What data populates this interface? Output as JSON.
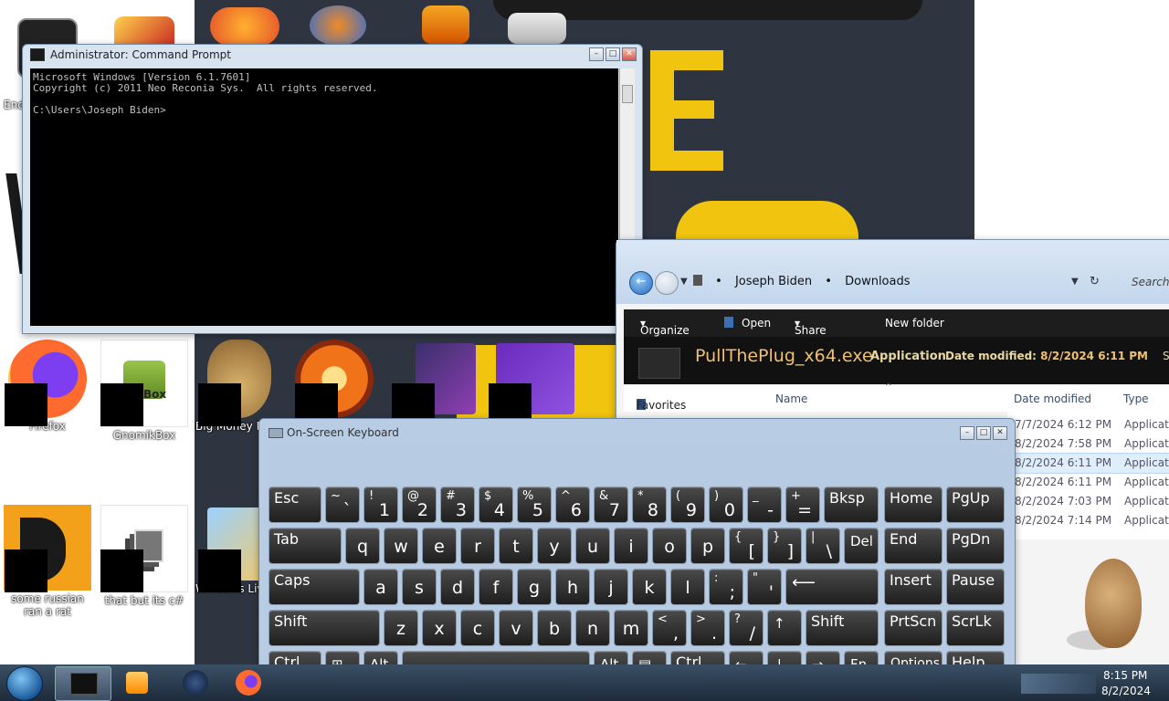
{
  "desktop": {
    "icons": [
      {
        "label": "Firefox"
      },
      {
        "label": "GnomikBox"
      },
      {
        "label": "Big Money D"
      },
      {
        "label": "some russian ran a rat"
      },
      {
        "label": "that but its c#"
      },
      {
        "label": "Windows Liv"
      },
      {
        "label": "End"
      }
    ],
    "gnomik_pic_text": "Box"
  },
  "cmd": {
    "title": "Administrator: Command Prompt",
    "lines": "Microsoft Windows [Version 6.1.7601]\nCopyright (c) 2011 Neo Reconia Sys.  All rights reserved.\n\nC:\\Users\\Joseph Biden>"
  },
  "explorer": {
    "breadcrumb": [
      "Joseph Biden",
      "Downloads"
    ],
    "search_placeholder": "Search D",
    "toolbar": {
      "organize": "Organize",
      "open": "Open",
      "share_with": "Share with",
      "new_folder": "New folder"
    },
    "selected_name": "PullThePlug_x64.exe",
    "selected_type": "Application",
    "selected_date_label": "Date modified:",
    "selected_date": "8/2/2024 6:11 PM",
    "selected_extra": "Si",
    "nav_favorites": "Favorites",
    "columns": {
      "name": "Name",
      "date_modified": "Date modified",
      "type": "Type"
    },
    "rows": [
      {
        "date": "7/7/2024 6:12 PM",
        "type": "Applicatio"
      },
      {
        "date": "8/2/2024 7:58 PM",
        "type": "Applicatio"
      },
      {
        "date": "8/2/2024 6:11 PM",
        "type": "Applicatio"
      },
      {
        "date": "8/2/2024 6:11 PM",
        "type": "Applicatio"
      },
      {
        "date": "8/2/2024 7:03 PM",
        "type": "Applicatio"
      },
      {
        "date": "8/2/2024 7:14 PM",
        "type": "Applicatio"
      }
    ]
  },
  "osk": {
    "title": "On-Screen Keyboard",
    "keys": {
      "esc": "Esc",
      "tilde_top": "~",
      "tilde_low": "`",
      "n1_top": "!",
      "n1": "1",
      "n2_top": "@",
      "n2": "2",
      "n3_top": "#",
      "n3": "3",
      "n4_top": "$",
      "n4": "4",
      "n5_top": "%",
      "n5": "5",
      "n6_top": "^",
      "n6": "6",
      "n7_top": "&",
      "n7": "7",
      "n8_top": "*",
      "n8": "8",
      "n9_top": "(",
      "n9": "9",
      "n0_top": ")",
      "n0": "0",
      "minus_top": "_",
      "minus": "-",
      "eq_top": "+",
      "eq": "=",
      "bksp": "Bksp",
      "home": "Home",
      "pgup": "PgUp",
      "tab": "Tab",
      "q": "q",
      "w": "w",
      "e": "e",
      "r": "r",
      "t": "t",
      "y": "y",
      "u": "u",
      "i": "i",
      "o": "o",
      "p": "p",
      "lb_top": "{",
      "lb": "[",
      "rb_top": "}",
      "rb": "]",
      "bs_top": "|",
      "bs": "\\",
      "del": "Del",
      "end": "End",
      "pgdn": "PgDn",
      "caps": "Caps",
      "a": "a",
      "s": "s",
      "d": "d",
      "f": "f",
      "g": "g",
      "h": "h",
      "j": "j",
      "k": "k",
      "l": "l",
      "semi_top": ":",
      "semi": ";",
      "quote_top": "\"",
      "quote": "'",
      "enter": "⟵",
      "insert": "Insert",
      "pause": "Pause",
      "shift": "Shift",
      "z": "z",
      "x": "x",
      "c": "c",
      "v": "v",
      "b": "b",
      "n": "n",
      "m": "m",
      "comma_top": "<",
      "comma": ",",
      "dot_top": ">",
      "dot": ".",
      "slash_top": "?",
      "slash": "/",
      "up": "↑",
      "prtscn": "PrtScn",
      "scrlk": "ScrLk",
      "ctrl": "Ctrl",
      "win": "⊞",
      "alt": "Alt",
      "menu": "▤",
      "left": "←",
      "down": "↓",
      "right": "→",
      "fn": "Fn",
      "options": "Options",
      "help": "Help"
    }
  },
  "taskbar": {
    "time": "8:15 PM",
    "date": "8/2/2024"
  }
}
